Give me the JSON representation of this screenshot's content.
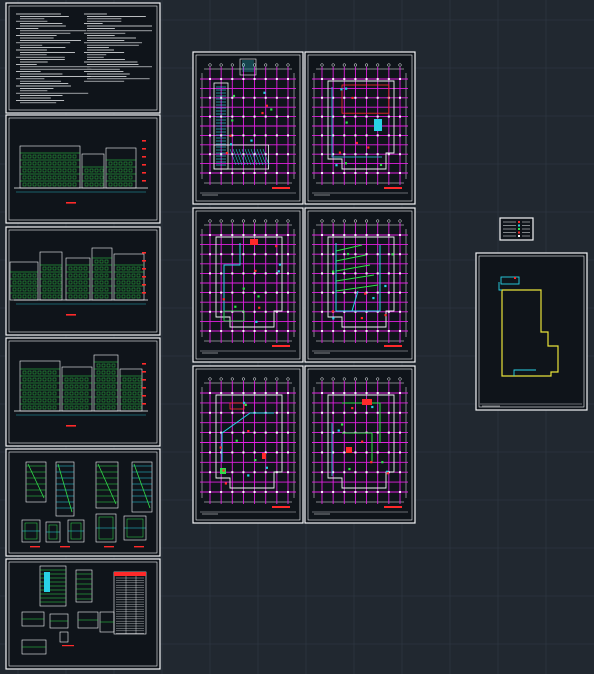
{
  "app": {
    "type": "CAD model space (drawing sheets layout)",
    "background_color": "#212830",
    "grid_color": "#2d3540"
  },
  "colors": {
    "sheet_frame": "#f2f4f6",
    "grid_axis": "#e020e0",
    "cyan": "#28d2e6",
    "green": "#30e04a",
    "red": "#ff2a2a",
    "yellow": "#e8e23a",
    "white": "#f2f4f6"
  },
  "sheets": [
    {
      "id": "notes",
      "kind": "text"
    },
    {
      "id": "elevation-1",
      "kind": "elevation"
    },
    {
      "id": "elevation-2",
      "kind": "elevation"
    },
    {
      "id": "elevation-3",
      "kind": "elevation"
    },
    {
      "id": "details-1",
      "kind": "details"
    },
    {
      "id": "details-2",
      "kind": "details"
    },
    {
      "id": "plan-1",
      "kind": "plan"
    },
    {
      "id": "plan-2",
      "kind": "plan"
    },
    {
      "id": "plan-3",
      "kind": "plan"
    },
    {
      "id": "plan-4",
      "kind": "plan"
    },
    {
      "id": "plan-5",
      "kind": "plan"
    },
    {
      "id": "plan-6",
      "kind": "plan"
    },
    {
      "id": "legend",
      "kind": "legend"
    },
    {
      "id": "site-plan",
      "kind": "site"
    }
  ]
}
